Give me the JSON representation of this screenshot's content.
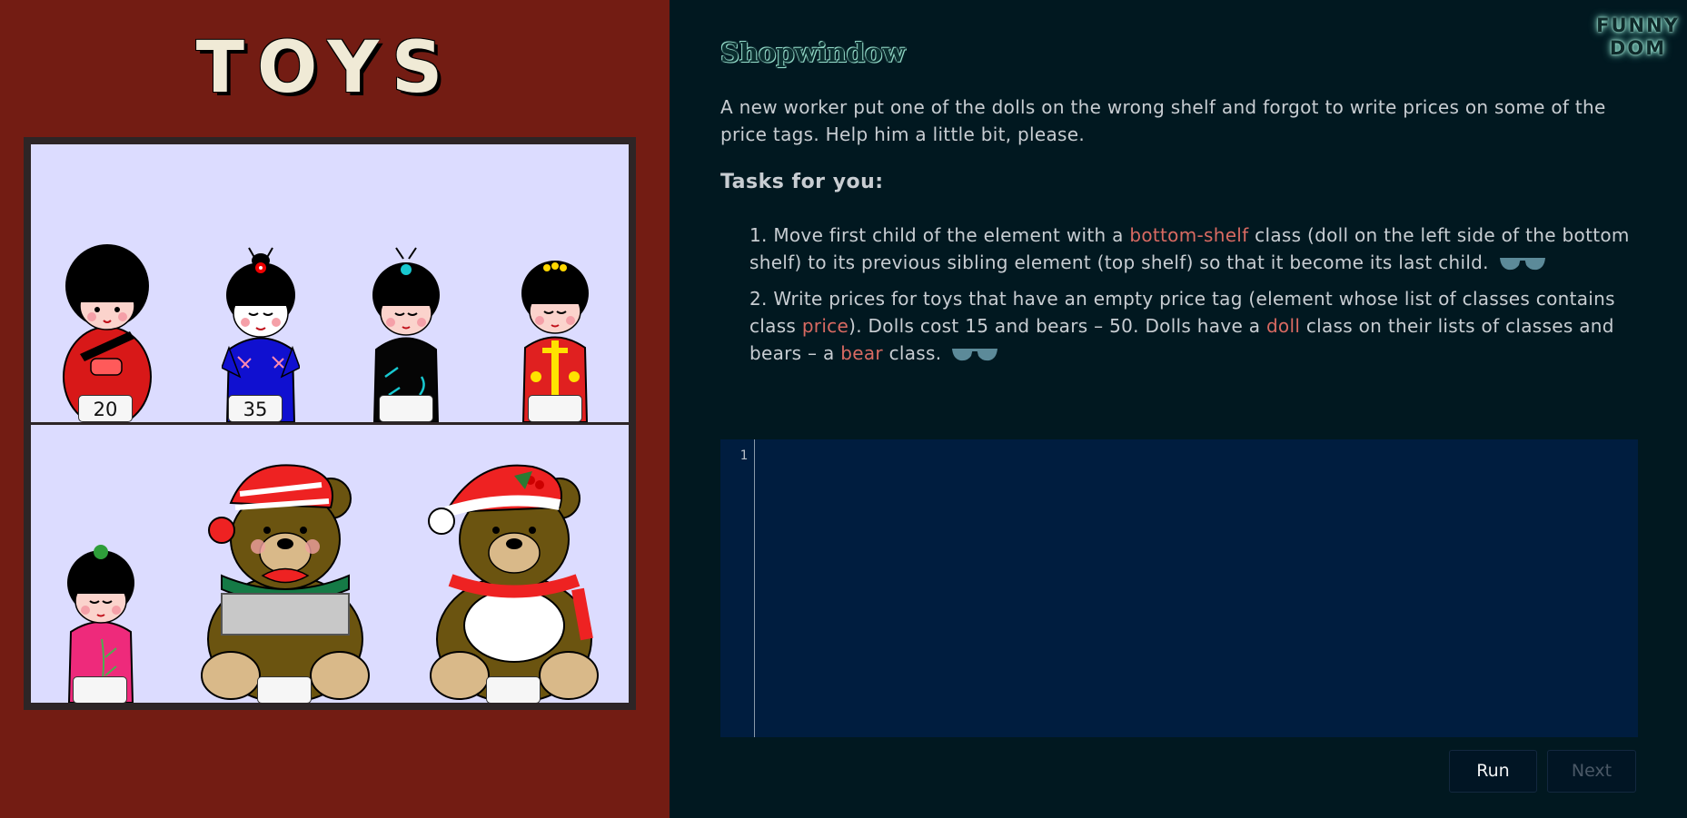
{
  "left_panel": {
    "title": "TOYS",
    "colors": {
      "background": "#731c13",
      "shelf": "#dcdcff",
      "frame": "#2d2526"
    },
    "top_shelf": {
      "toys": [
        {
          "kind": "doll",
          "icon": "kokeshi-red-doll-icon",
          "price": "20"
        },
        {
          "kind": "doll",
          "icon": "kokeshi-blue-doll-icon",
          "price": "35"
        },
        {
          "kind": "doll",
          "icon": "kokeshi-black-doll-icon",
          "price": ""
        },
        {
          "kind": "doll",
          "icon": "kokeshi-red-yellow-doll-icon",
          "price": ""
        }
      ]
    },
    "bottom_shelf": {
      "toys": [
        {
          "kind": "doll",
          "icon": "kokeshi-pink-doll-icon",
          "price": ""
        },
        {
          "kind": "bear",
          "icon": "teddy-bear-gift-icon",
          "price": ""
        },
        {
          "kind": "bear",
          "icon": "teddy-bear-santa-icon",
          "price": ""
        }
      ]
    }
  },
  "right_panel": {
    "colors": {
      "background": "#011820",
      "highlight": "#d96a62",
      "editor": "#001d3f"
    },
    "title": "Shopwindow",
    "logo": {
      "line1": "FUNNY",
      "line2": "DOM"
    },
    "intro": "A new worker put one of the dolls on the wrong shelf and forgot to write prices on some of the price tags. Help him a little bit, please.",
    "tasks_heading": "Tasks for you:",
    "task1": {
      "part1": "1. Move first child of the element with a ",
      "hl1": "bottom-shelf",
      "part2": " class (doll on the left side of the bottom shelf) to its previous sibling element (top shelf) so that it become its last child.",
      "hint_icon": "glasses-icon"
    },
    "task2": {
      "part1": "2. Write prices for toys that have an empty price tag (element whose list of classes contains class ",
      "hl1": "price",
      "part2": "). Dolls cost 15 and bears – 50. Dolls have a ",
      "hl2": "doll",
      "part3": " class on their lists of classes and bears – a ",
      "hl3": "bear",
      "part4": " class.",
      "hint_icon": "glasses-icon"
    },
    "editor": {
      "line_number": "1",
      "content": ""
    },
    "buttons": {
      "run": "Run",
      "next": "Next"
    }
  }
}
